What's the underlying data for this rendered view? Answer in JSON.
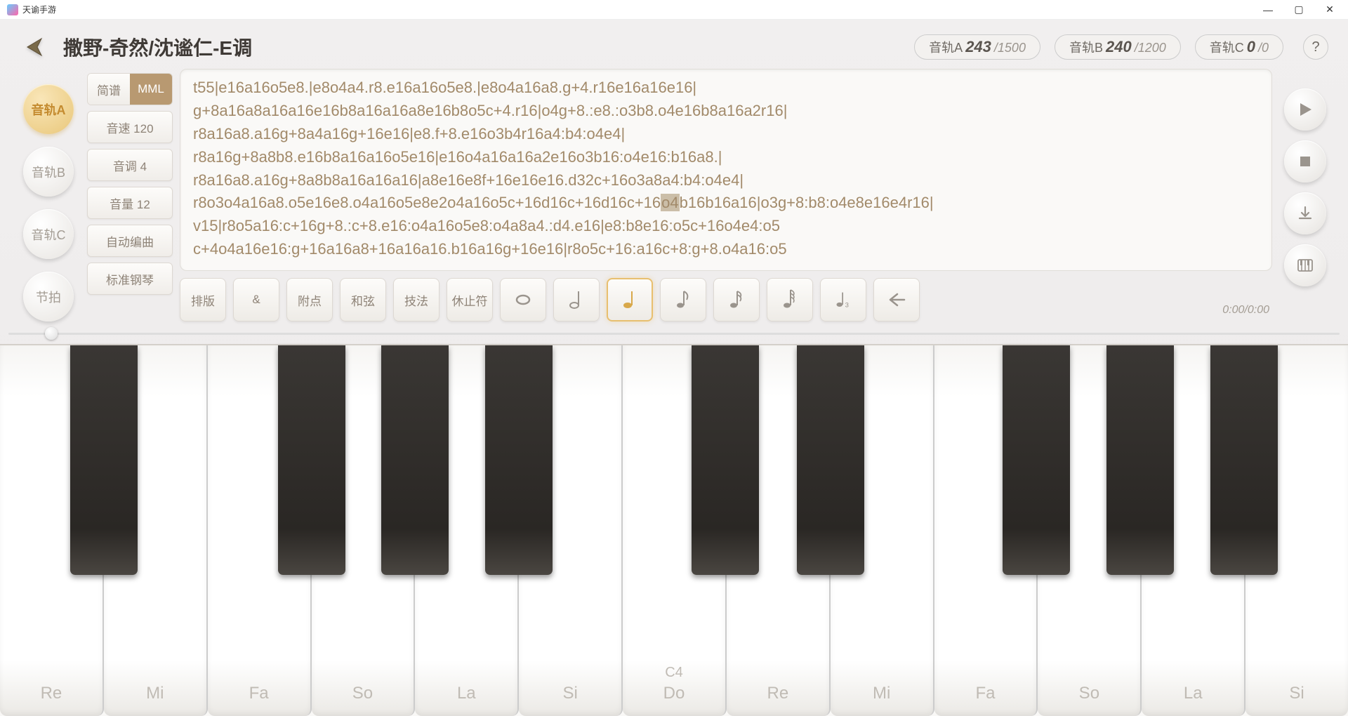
{
  "window": {
    "title": "天谕手游"
  },
  "header": {
    "song_title": "撒野-奇然/沈谧仁-E调",
    "tracks": [
      {
        "label": "音轨A",
        "count": "243",
        "max": "/1500"
      },
      {
        "label": "音轨B",
        "count": "240",
        "max": "/1200"
      },
      {
        "label": "音轨C",
        "count": "0",
        "max": "/0"
      }
    ],
    "help": "?"
  },
  "left_tabs": {
    "a": "音轨A",
    "b": "音轨B",
    "c": "音轨C",
    "tempo": "节拍"
  },
  "mid": {
    "notation_tab": "简谱",
    "mml_tab": "MML",
    "speed": "音速 120",
    "key": "音调 4",
    "volume": "音量 12",
    "auto": "自动编曲",
    "instrument": "标准钢琴"
  },
  "mml_pre": "t55|e16a16o5e8.|e8o4a4.r8.e16a16o5e8.|e8o4a16a8.g+4.r16e16a16e16|\ng+8a16a8a16a16e16b8a16a16a8e16b8o5c+4.r16|o4g+8.:e8.:o3b8.o4e16b8a16a2r16|\nr8a16a8.a16g+8a4a16g+16e16|e8.f+8.e16o3b4r16a4:b4:o4e4|\nr8a16g+8a8b8.e16b8a16a16o5e16|e16o4a16a16a2e16o3b16:o4e16:b16a8.|\nr8a16a8.a16g+8a8b8a16a16a16|a8e16e8f+16e16e16.d32c+16o3a8a4:b4:o4e4|\nr8o3o4a16a8.o5e16e8.o4a16o5e8e2o4a16o5c+16d16c+16d16c+16",
  "mml_hl": "o4",
  "mml_post": "b16b16a16|o3g+8:b8:o4e8e16e4r16|\nv15|r8o5a16:c+16g+8.:c+8.e16:o4a16o5e8:o4a8a4.:d4.e16|e8:b8e16:o5c+16o4e4:o5\nc+4o4a16e16:g+16a16a8+16a16a16.b16a16g+16e16|r8o5c+16:a16c+8:g+8.o4a16:o5",
  "tools": {
    "format": "排版",
    "amp": "&",
    "dot": "附点",
    "chord": "和弦",
    "tech": "技法",
    "rest": "休止符"
  },
  "time": "0:00/0:00",
  "keys": {
    "white": [
      "Re",
      "Mi",
      "Fa",
      "So",
      "La",
      "Si",
      "Do",
      "Re",
      "Mi",
      "Fa",
      "So",
      "La",
      "Si"
    ],
    "c4_label": "C4",
    "c4_sub": "Do"
  }
}
